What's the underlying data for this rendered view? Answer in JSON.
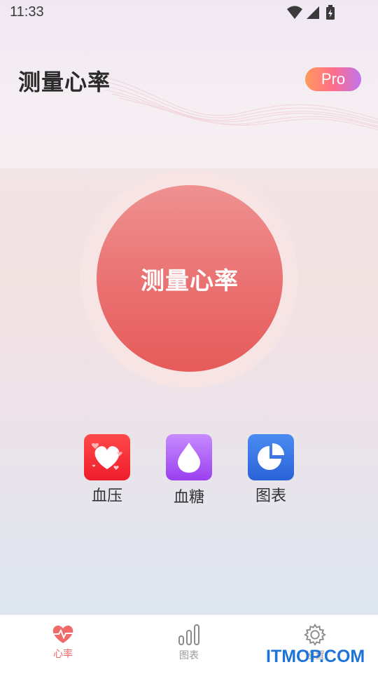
{
  "status_bar": {
    "time": "11:33"
  },
  "header": {
    "title": "测量心率",
    "pro_badge": "Pro"
  },
  "measure": {
    "button_label": "测量心率"
  },
  "features": [
    {
      "label": "血压",
      "icon": "heart-icon"
    },
    {
      "label": "血糖",
      "icon": "drop-icon"
    },
    {
      "label": "图表",
      "icon": "pie-chart-icon"
    }
  ],
  "bottom_nav": [
    {
      "label": "心率",
      "icon": "heart-pulse-icon",
      "active": true
    },
    {
      "label": "图表",
      "icon": "bar-chart-icon",
      "active": false
    },
    {
      "label": "设置",
      "icon": "gear-icon",
      "active": false
    }
  ],
  "watermark": {
    "text": "ITMOP.COM"
  },
  "colors": {
    "accent": "#e65b5a",
    "nav_active": "#f06a6a",
    "pro_gradient": [
      "#ff9a5a",
      "#ff6e8a",
      "#c074ee"
    ]
  }
}
